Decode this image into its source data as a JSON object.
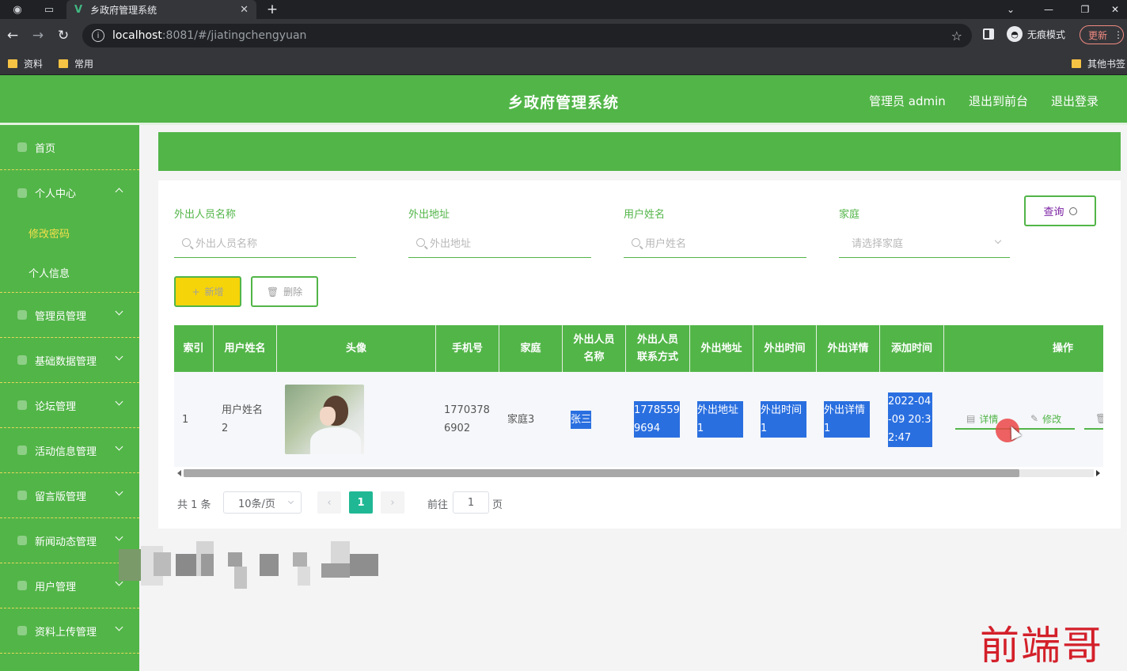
{
  "browser": {
    "tab_title": "乡政府管理系统",
    "url_host": "localhost",
    "url_rest": ":8081/#/jiatingchengyuan",
    "incognito_label": "无痕模式",
    "update_label": "更新",
    "bookmarks": [
      "资料",
      "常用"
    ],
    "other_bookmarks": "其他书签"
  },
  "header": {
    "title": "乡政府管理系统",
    "admin_label": "管理员 admin",
    "exit_front": "退出到前台",
    "logout": "退出登录"
  },
  "sidebar": {
    "items": [
      {
        "label": "首页"
      },
      {
        "label": "个人中心"
      },
      {
        "label": "修改密码"
      },
      {
        "label": "个人信息"
      },
      {
        "label": "管理员管理"
      },
      {
        "label": "基础数据管理"
      },
      {
        "label": "论坛管理"
      },
      {
        "label": "活动信息管理"
      },
      {
        "label": "留言版管理"
      },
      {
        "label": "新闻动态管理"
      },
      {
        "label": "用户管理"
      },
      {
        "label": "资料上传管理"
      }
    ]
  },
  "filters": {
    "name_label": "外出人员名称",
    "name_placeholder": "外出人员名称",
    "address_label": "外出地址",
    "address_placeholder": "外出地址",
    "user_label": "用户姓名",
    "user_placeholder": "用户姓名",
    "family_label": "家庭",
    "family_placeholder": "请选择家庭",
    "query_button": "查询"
  },
  "actions": {
    "add_button": "新增",
    "delete_button": "删除"
  },
  "table": {
    "headers": [
      "索引",
      "用户姓名",
      "头像",
      "手机号",
      "家庭",
      "外出人员名称",
      "外出人员联系方式",
      "外出地址",
      "外出时间",
      "外出详情",
      "添加时间",
      "操作"
    ],
    "row": {
      "index": "1",
      "user_name": "用户姓名2",
      "phone": "17703786902",
      "family": "家庭3",
      "out_name": "张三",
      "out_contact": "17785599694",
      "out_address": "外出地址1",
      "out_time": "外出时间1",
      "out_detail": "外出详情1",
      "added_time": "2022-04-09 20:32:47",
      "op_detail": "详情",
      "op_edit": "修改"
    }
  },
  "pagination": {
    "total": "共 1 条",
    "page_size": "10条/页",
    "prev": "‹",
    "current": "1",
    "next": "›",
    "goto_label": "前往",
    "goto_value": "1",
    "page_word": "页"
  },
  "watermark": "前端哥"
}
